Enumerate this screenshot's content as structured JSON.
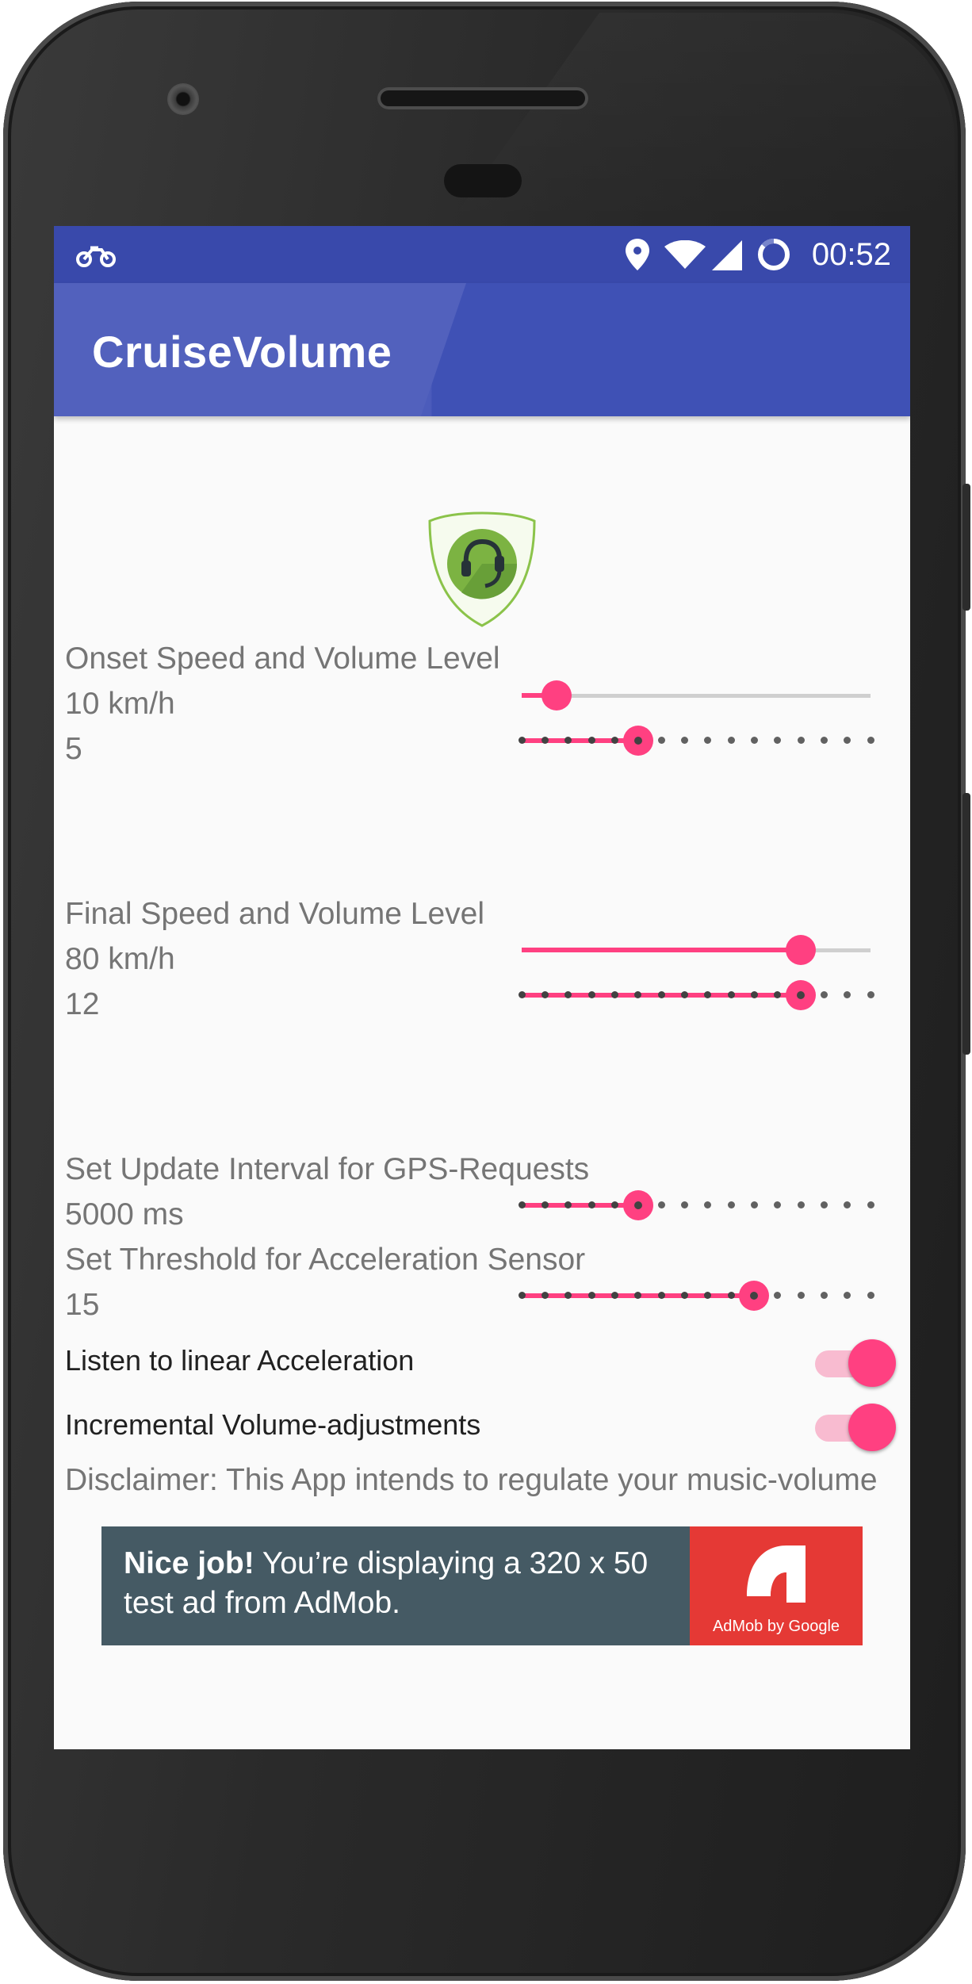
{
  "status_bar": {
    "time": "00:52",
    "icons": [
      "motorcycle-icon",
      "location-icon",
      "wifi-icon",
      "signal-icon",
      "battery-charging-icon"
    ]
  },
  "app_bar": {
    "title": "CruiseVolume"
  },
  "logo": {
    "icon": "headphones-shield-icon"
  },
  "onset": {
    "heading": "Onset Speed and Volume Level",
    "speed_text": "10 km/h",
    "volume_text": "5",
    "speed_fraction": 0.1,
    "volume_step": 5,
    "volume_steps_total": 15
  },
  "final": {
    "heading": "Final Speed and Volume Level",
    "speed_text": "80 km/h",
    "volume_text": "12",
    "speed_fraction": 0.8,
    "volume_step": 12,
    "volume_steps_total": 15
  },
  "gps": {
    "heading": "Set Update Interval for GPS-Requests",
    "value_text": "5000 ms",
    "step": 5,
    "steps_total": 15
  },
  "accel": {
    "heading": "Set Threshold for Acceleration Sensor",
    "value_text": "15",
    "step": 10,
    "steps_total": 15
  },
  "switches": {
    "linear_label": "Listen to linear Acceleration",
    "linear_on": true,
    "incremental_label": "Incremental Volume-adjustments",
    "incremental_on": true
  },
  "disclaimer": "Disclaimer: This App intends to regulate your music-volume of your phone by measuring your speed. Use at your own risk.",
  "ad": {
    "strong": "Nice job!",
    "text": " You’re displaying a 320 x 50 test ad from AdMob.",
    "badge_caption": "AdMob by Google",
    "brand_color": "#e53935",
    "background_color": "#455a64"
  },
  "colors": {
    "primary": "#3f51b5",
    "status_bar": "#3949ab",
    "accent": "#ff4081"
  }
}
